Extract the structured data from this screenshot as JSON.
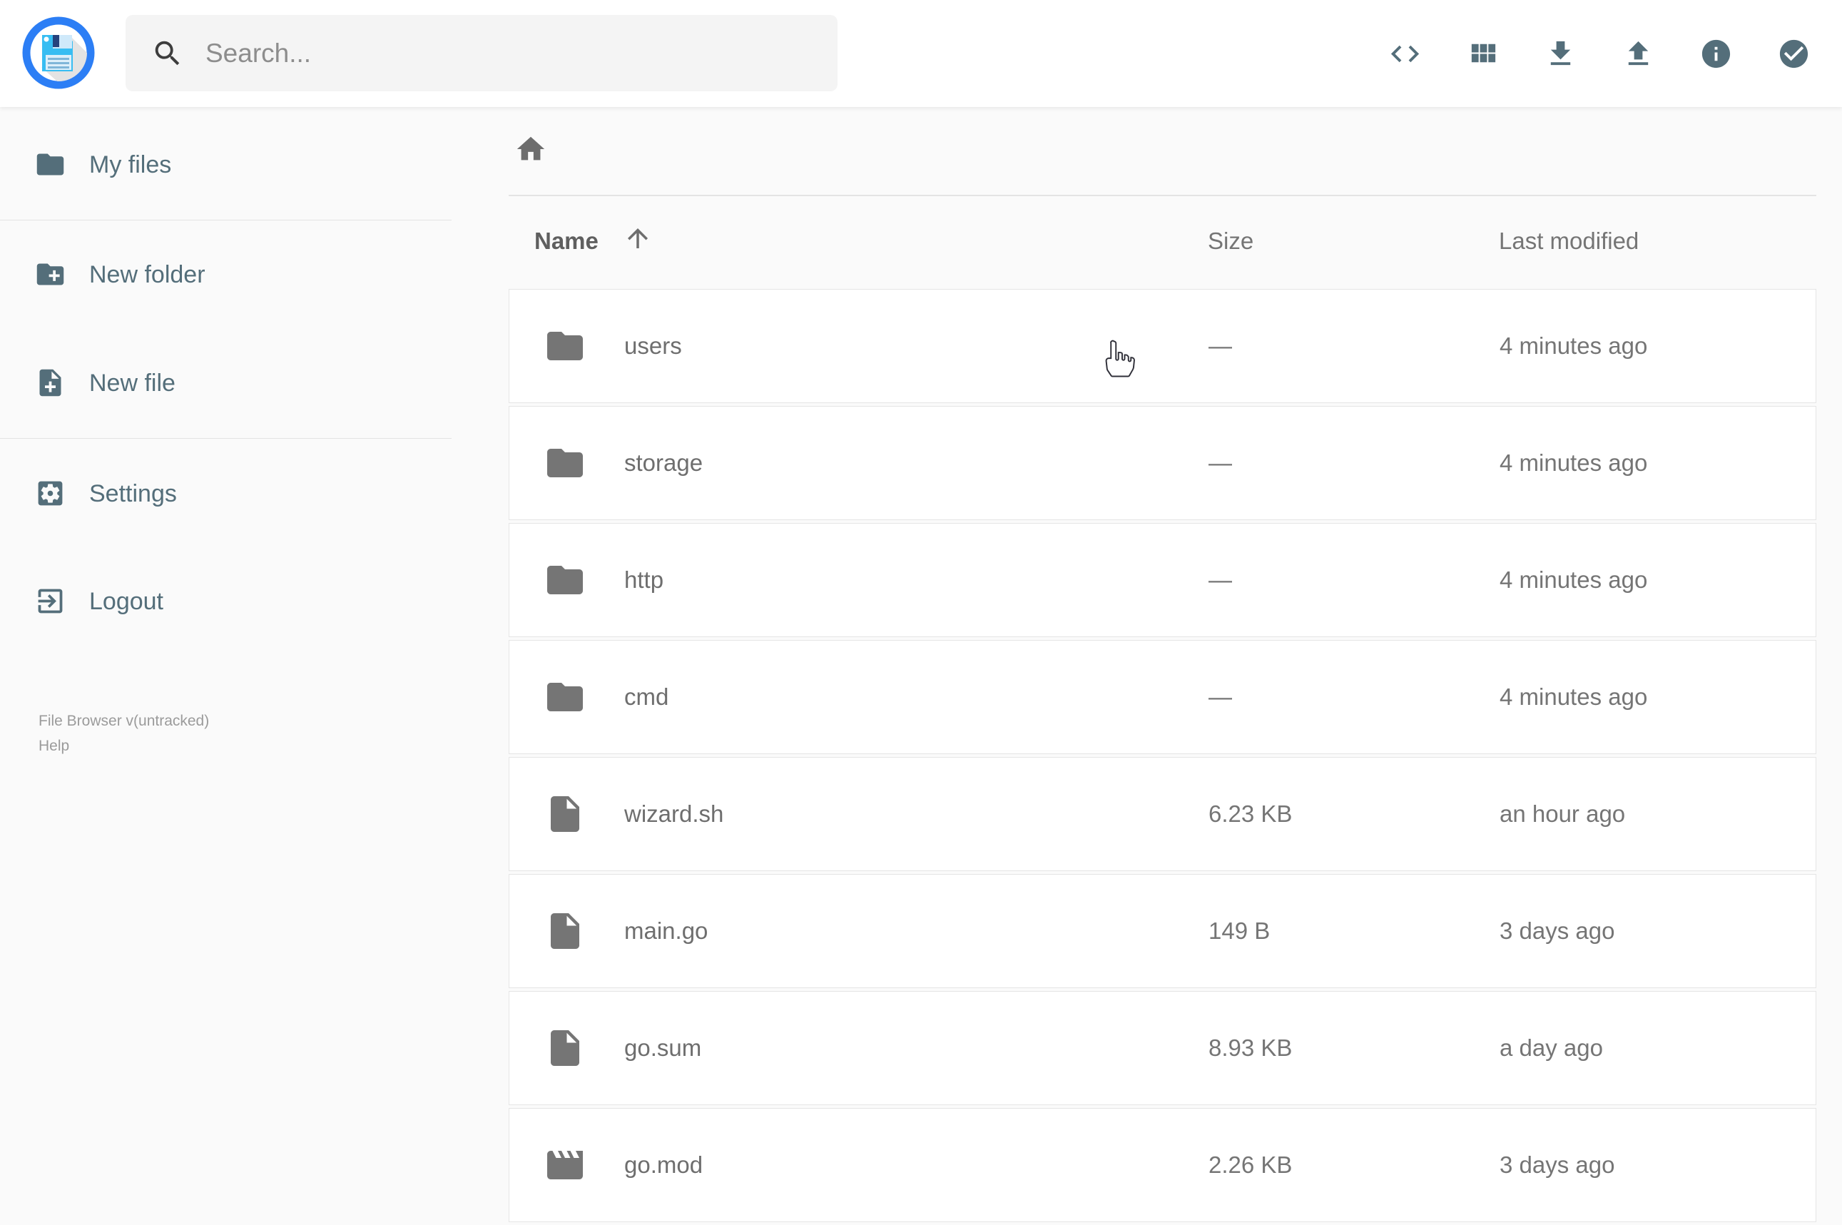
{
  "colors": {
    "accent_blue": "#2c7ef5",
    "floppy_cyan": "#38bdf2",
    "icon_slate": "#546e7a",
    "icon_gray": "#757575",
    "text_gray": "#6e6e6e",
    "muted_gray": "#9b9b9b"
  },
  "header": {
    "logo_icon": "floppy-disk-logo",
    "search": {
      "placeholder": "Search..."
    },
    "actions": [
      {
        "icon": "code-icon"
      },
      {
        "icon": "grid-view-icon"
      },
      {
        "icon": "download-icon"
      },
      {
        "icon": "upload-icon"
      },
      {
        "icon": "info-icon"
      },
      {
        "icon": "check-circle-icon"
      }
    ]
  },
  "sidebar": {
    "items": [
      {
        "label": "My files",
        "icon": "folder-icon"
      },
      {
        "label": "New folder",
        "icon": "new-folder-icon"
      },
      {
        "label": "New file",
        "icon": "new-file-icon"
      },
      {
        "label": "Settings",
        "icon": "settings-icon"
      },
      {
        "label": "Logout",
        "icon": "logout-icon"
      }
    ],
    "footer": {
      "version": "File Browser v(untracked)",
      "help": "Help"
    }
  },
  "main": {
    "breadcrumb": {
      "icon": "home-icon"
    },
    "table": {
      "columns": {
        "name": "Name",
        "size": "Size",
        "modified": "Last modified"
      },
      "sort": {
        "column": "Name",
        "direction": "asc"
      },
      "rows": [
        {
          "name": "users",
          "type": "folder",
          "icon": "folder-icon",
          "size": "—",
          "modified": "4 minutes ago"
        },
        {
          "name": "storage",
          "type": "folder",
          "icon": "folder-icon",
          "size": "—",
          "modified": "4 minutes ago"
        },
        {
          "name": "http",
          "type": "folder",
          "icon": "folder-icon",
          "size": "—",
          "modified": "4 minutes ago"
        },
        {
          "name": "cmd",
          "type": "folder",
          "icon": "folder-icon",
          "size": "—",
          "modified": "4 minutes ago"
        },
        {
          "name": "wizard.sh",
          "type": "file",
          "icon": "file-icon",
          "size": "6.23 KB",
          "modified": "an hour ago"
        },
        {
          "name": "main.go",
          "type": "file",
          "icon": "file-icon",
          "size": "149 B",
          "modified": "3 days ago"
        },
        {
          "name": "go.sum",
          "type": "file",
          "icon": "file-icon",
          "size": "8.93 KB",
          "modified": "a day ago"
        },
        {
          "name": "go.mod",
          "type": "file",
          "icon": "movie-icon",
          "size": "2.26 KB",
          "modified": "3 days ago"
        }
      ]
    }
  }
}
